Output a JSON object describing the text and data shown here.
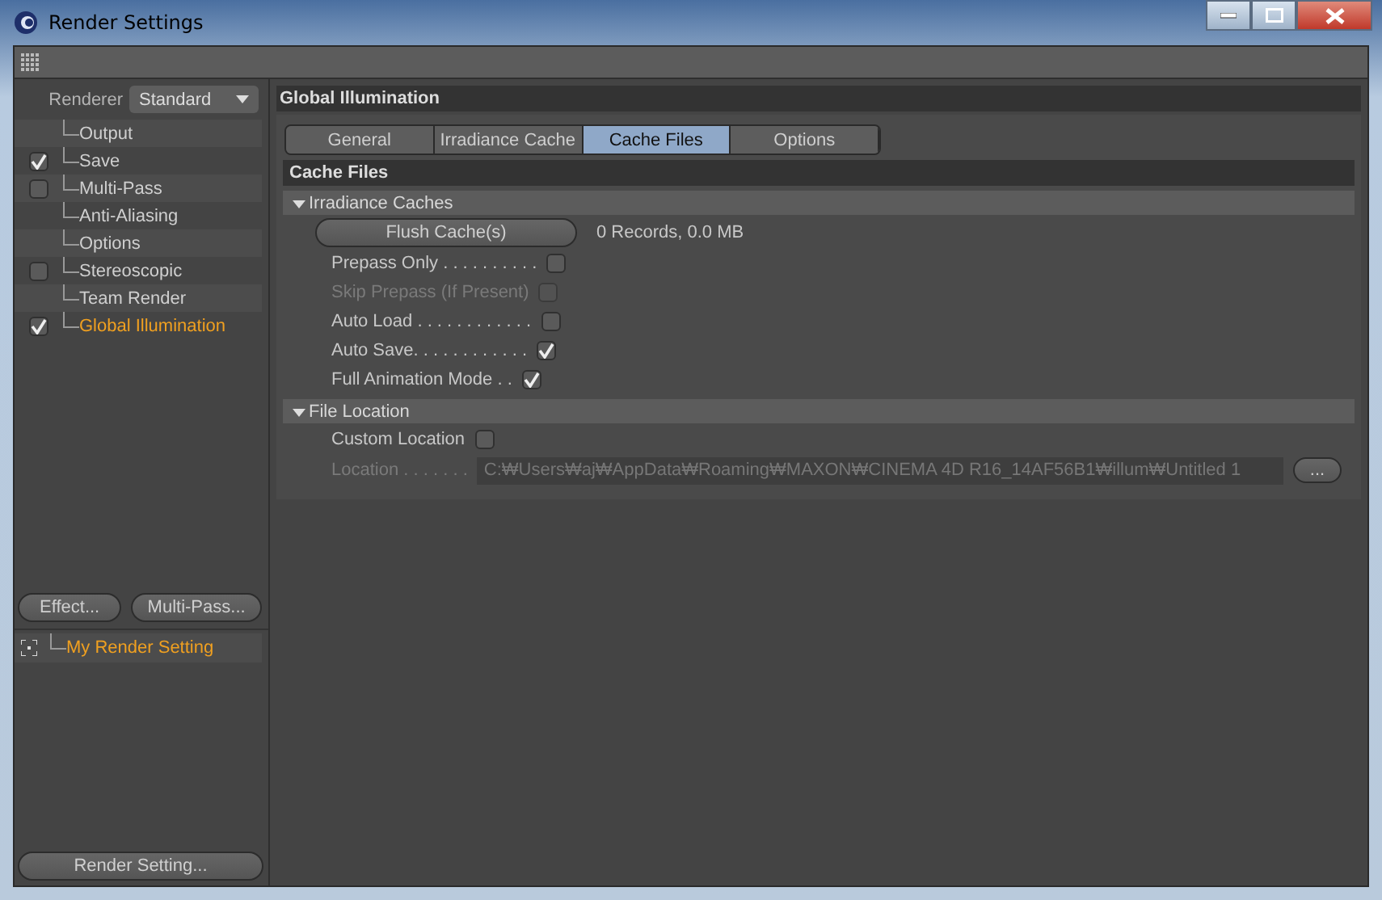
{
  "window": {
    "title": "Render Settings"
  },
  "renderer": {
    "label": "Renderer",
    "value": "Standard"
  },
  "sidebar": {
    "items": [
      {
        "label": "Output",
        "kind": "plain",
        "selected": false
      },
      {
        "label": "Save",
        "kind": "toggle",
        "checked": true,
        "selected": false
      },
      {
        "label": "Multi-Pass",
        "kind": "toggle",
        "checked": false,
        "selected": false
      },
      {
        "label": "Anti-Aliasing",
        "kind": "plain",
        "selected": false
      },
      {
        "label": "Options",
        "kind": "plain",
        "selected": false
      },
      {
        "label": "Stereoscopic",
        "kind": "toggle",
        "checked": false,
        "selected": false
      },
      {
        "label": "Team Render",
        "kind": "plain",
        "selected": false
      },
      {
        "label": "Global Illumination",
        "kind": "toggle",
        "checked": true,
        "selected": true
      }
    ]
  },
  "sidebar_buttons": [
    "Effect...",
    "Multi-Pass..."
  ],
  "presets": [
    {
      "label": "My Render Setting",
      "selected": true
    }
  ],
  "bottom_button": "Render Setting...",
  "panel": {
    "title": "Global Illumination",
    "tabs": [
      {
        "label": "General",
        "selected": false
      },
      {
        "label": "Irradiance Cache",
        "selected": false
      },
      {
        "label": "Cache Files",
        "selected": true
      },
      {
        "label": "Options",
        "selected": false
      }
    ],
    "section": "Cache Files",
    "groups": [
      {
        "title": "Irradiance Caches",
        "expanded": true,
        "rows": [
          {
            "kind": "button",
            "label": "Flush Cache(s)",
            "info": "0 Records, 0.0 MB"
          },
          {
            "kind": "checkbox",
            "label": "Prepass Only . . . . . . . . . .",
            "checked": false,
            "disabled": false
          },
          {
            "kind": "checkbox",
            "label": "Skip Prepass (If Present)",
            "checked": false,
            "disabled": true
          },
          {
            "kind": "checkbox",
            "label": "Auto Load . . . . . . . . . . . .",
            "checked": false,
            "disabled": false
          },
          {
            "kind": "checkbox",
            "label": "Auto Save. . . . . . . . . . . .",
            "checked": true,
            "disabled": false
          },
          {
            "kind": "checkbox",
            "label": "Full Animation Mode . .",
            "checked": true,
            "disabled": false
          }
        ]
      },
      {
        "title": "File Location",
        "expanded": true,
        "rows": [
          {
            "kind": "checkbox",
            "label": "Custom Location",
            "checked": false,
            "disabled": false
          },
          {
            "kind": "path",
            "label": "Location . . . . . . .",
            "value": "C:₩Users₩aj₩AppData₩Roaming₩MAXON₩CINEMA 4D R16_14AF56B1₩illum₩Untitled 1",
            "button": "...",
            "disabled": true
          }
        ]
      }
    ]
  }
}
